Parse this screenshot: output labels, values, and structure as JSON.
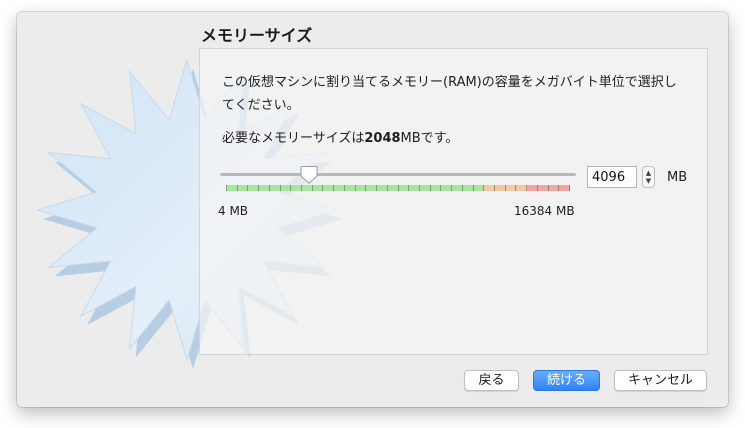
{
  "dialog": {
    "title": "メモリーサイズ",
    "description": "この仮想マシンに割り当てるメモリー(RAM)の容量をメガバイト単位で選択してください。",
    "required_prefix": "必要なメモリーサイズは",
    "required_value": "2048",
    "required_suffix": "MBです。"
  },
  "memory": {
    "value": "4096",
    "unit": "MB",
    "min_label": "4 MB",
    "max_label": "16384 MB",
    "slider_fraction": 0.25,
    "zones": [
      {
        "name": "recommended",
        "fraction": 0.75,
        "color": "#a8e6a0"
      },
      {
        "name": "caution",
        "fraction": 0.125,
        "color": "#f3c7a4"
      },
      {
        "name": "excessive",
        "fraction": 0.125,
        "color": "#f2a6a6"
      }
    ]
  },
  "buttons": {
    "back": "戻る",
    "continue": "続ける",
    "cancel": "キャンセル"
  },
  "icons": {
    "background": "starburst-icon",
    "stepper_up": "▲",
    "stepper_down": "▼"
  }
}
